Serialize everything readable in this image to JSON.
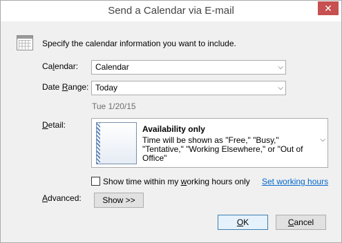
{
  "window": {
    "title": "Send a Calendar via E-mail",
    "close_glyph": "✕"
  },
  "intro_text": "Specify the calendar information you want to include.",
  "calendar": {
    "label_pre": "Ca",
    "label_key": "l",
    "label_post": "endar:",
    "value": "Calendar"
  },
  "date_range": {
    "label_pre": "Date ",
    "label_key": "R",
    "label_post": "ange:",
    "value": "Today",
    "date_hint": "Tue 1/20/15"
  },
  "detail": {
    "label_key": "D",
    "label_post": "etail:",
    "title": "Availability only",
    "description": "Time will be shown as \"Free,\" \"Busy,\" \"Tentative,\" \"Working Elsewhere,\" or \"Out of Office\""
  },
  "working_hours": {
    "checkbox_pre": "Show time within my ",
    "checkbox_key": "w",
    "checkbox_post": "orking hours only",
    "checked": false,
    "link_pre": "Set ",
    "link_key": "w",
    "link_post": "orking hours"
  },
  "advanced": {
    "label_key": "A",
    "label_post": "dvanced:",
    "button_label": "Show >>"
  },
  "footer": {
    "ok_key": "O",
    "ok_post": "K",
    "cancel_key": "C",
    "cancel_post": "ancel"
  },
  "icons": {
    "calendar": "calendar-icon",
    "dropdown": "chevron-down-icon",
    "close": "close-icon"
  },
  "colors": {
    "link": "#0066cc",
    "close_button": "#c75050",
    "ok_border": "#3c7fb1"
  }
}
